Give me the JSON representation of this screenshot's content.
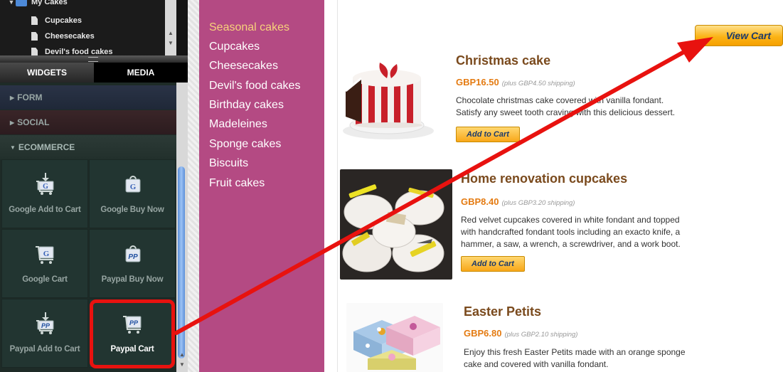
{
  "tree": {
    "items": [
      {
        "label": "My Cakes"
      },
      {
        "label": "Cupcakes"
      },
      {
        "label": "Cheesecakes"
      },
      {
        "label": "Devil's food cakes"
      }
    ]
  },
  "panel_tabs": {
    "widgets": "WIDGETS",
    "media": "MEDIA"
  },
  "sections": {
    "form": "FORM",
    "social": "SOCIAL",
    "ecommerce": "ECOMMERCE"
  },
  "widgets": [
    {
      "label": "Google Add to Cart",
      "icon": "google-add-to-cart-icon"
    },
    {
      "label": "Google Buy Now",
      "icon": "google-buy-now-icon"
    },
    {
      "label": "Google Cart",
      "icon": "google-cart-icon"
    },
    {
      "label": "Paypal Buy Now",
      "icon": "paypal-buy-now-icon"
    },
    {
      "label": "Paypal Add to Cart",
      "icon": "paypal-add-to-cart-icon"
    },
    {
      "label": "Paypal Cart",
      "icon": "paypal-cart-icon",
      "selected": true
    }
  ],
  "menu": {
    "items": [
      {
        "label": "Seasonal cakes",
        "active": true
      },
      {
        "label": "Cupcakes"
      },
      {
        "label": "Cheesecakes"
      },
      {
        "label": "Devil's food cakes"
      },
      {
        "label": "Birthday cakes"
      },
      {
        "label": "Madeleines"
      },
      {
        "label": "Sponge cakes"
      },
      {
        "label": "Biscuits"
      },
      {
        "label": "Fruit cakes"
      }
    ]
  },
  "cart": {
    "view_label": "View Cart"
  },
  "products": [
    {
      "title": "Christmas cake",
      "price": "GBP16.50",
      "shipping": "(plus GBP4.50 shipping)",
      "desc1": "Chocolate christmas cake covered with vanilla fondant.",
      "desc2": "Satisfy any sweet tooth craving with this delicious dessert.",
      "button": "Add to Cart"
    },
    {
      "title": "Home renovation cupcakes",
      "price": "GBP8.40",
      "shipping": "(plus GBP3.20 shipping)",
      "desc1": "Red velvet cupcakes covered in white fondant and topped",
      "desc2": "with handcrafted fondant tools including an exacto knife, a",
      "desc3": "hammer, a saw, a wrench, a screwdriver, and a work boot.",
      "button": "Add to Cart"
    },
    {
      "title": "Easter Petits",
      "price": "GBP6.80",
      "shipping": "(plus GBP2.10 shipping)",
      "desc1": "Enjoy this fresh Easter Petits made with an orange sponge",
      "desc2": "cake and covered with vanilla fondant."
    }
  ],
  "colors": {
    "menu_bg": "#b44a83",
    "accent": "#f6a000",
    "annotation": "#e8120f"
  }
}
